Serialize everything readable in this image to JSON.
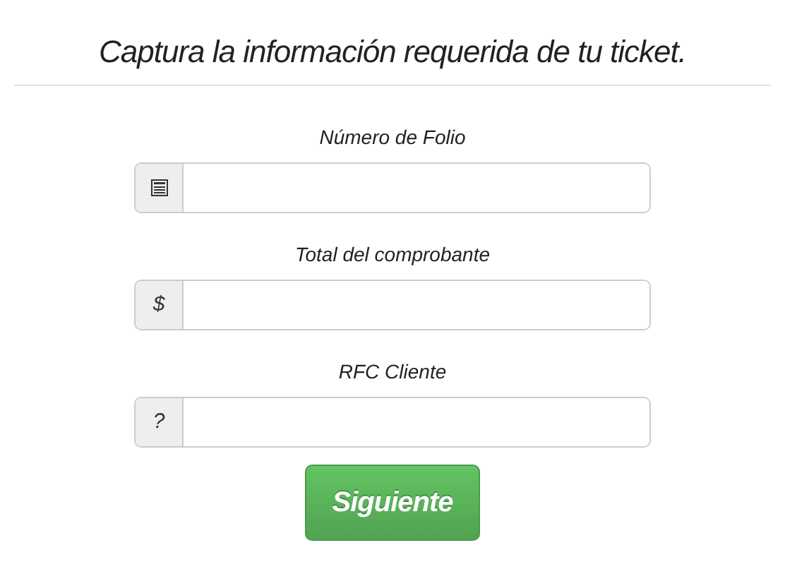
{
  "title": "Captura la información requerida de tu ticket.",
  "fields": [
    {
      "label": "Número de Folio",
      "kind": "icon"
    },
    {
      "label": "Total del comprobante",
      "kind": "text",
      "addon": "$"
    },
    {
      "label": "RFC Cliente",
      "kind": "text",
      "addon": "?"
    }
  ],
  "button": "Siguiente"
}
